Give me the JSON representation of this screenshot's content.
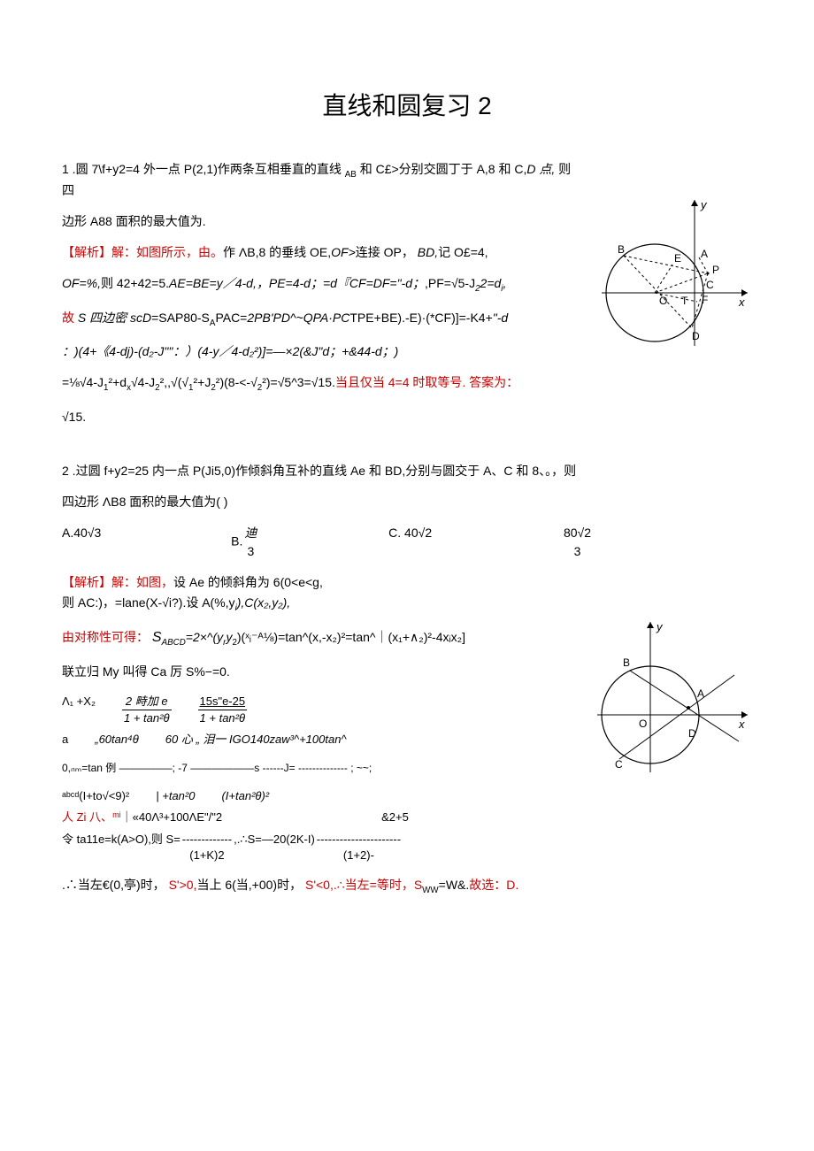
{
  "title": "直线和圆复习 2",
  "p1": {
    "num": "1",
    "stem_a": " .圆 7\\f+y2=4 外一点 P(2,1)作两条互相垂直的直线 ",
    "ab_small": "AB",
    "stem_b": " 和 C£>分别交圆丁于 A,8 和 C,",
    "d_it": "D 点,",
    "stem_c": " 则四",
    "stem_d": "边形 A88 面积的最大值为.",
    "sol_lead": "【解析】解：如图所示，由。",
    "sol_a": "作 ΛB,8 的垂线 OE,",
    "of_it": "OF>",
    "sol_b": "连接 OP，",
    "bd_it": "BD,",
    "sol_c": "记 O£=4,",
    "of_line_a": "OF=%,",
    "of_line_b": "则 42+42=5.",
    "of_line_c": "AE=BE=y／4-d,，PE=4-d；=d『CF=DF=\"-d；",
    "of_line_d": ",PF=√5-J",
    "of_line_e": "2",
    "of_line_f": "2=d",
    "of_line_g": "i",
    "of_line_h": ",",
    "s_line_a": "故 ",
    "s_line_b": "S 四边密 scD",
    "s_line_c": "=SAP80-S",
    "s_line_d": "A",
    "s_line_e": "PAC=",
    "s_line_f": "2PB'PD^~QPA·PC",
    "s_line_g": "TPE+BE).-E)·(*CF)]=-K4+",
    "s_line_h": "\"-d",
    "paren_line": "：)(4+《4-dj)-(d₂-J\"\"：）(4-y／4-d₂²)]=—×2(&J\"d；+&44-d；)",
    "eq_line_a": "=⅛√4-J",
    "eq_line_b": "1",
    "eq_line_c": "²+d",
    "eq_line_d": "x",
    "eq_line_e": "√4-J",
    "eq_line_f": "2",
    "eq_line_g": "²,,√(√",
    "eq_line_h": "1",
    "eq_line_i": "²+J",
    "eq_line_j": "2",
    "eq_line_k": "²)(8-<-√",
    "eq_line_l": "2",
    "eq_line_m": "²)=√5^3=√15.",
    "eq_red": "当且仅当 4=4 时取等号. 答案为：",
    "ans": "√15."
  },
  "p2": {
    "num": "2",
    "stem_a": " .过圆 f+y2=25 内一点 P(Ji5,0)作倾斜角互补的直线 Ae 和 BD,分别与圆交于 A、C 和 8、。，则",
    "stem_b": "四边形 ΛB8 面积的最大值为(        )",
    "optA": "A.40√3",
    "optB_a": "B.",
    "optB_b": "迪",
    "optB_c": "3",
    "optC": "C. 40√2",
    "optD_a": "80√2",
    "optD_b": "3",
    "sol_lead": "【解析】解：如图，",
    "sol_a": "设 Ae 的倾斜角为 6(0<e<g,",
    "sol_b": "则 AC:)，=lane(X-√i?).设 A(%,y",
    "sol_c": "i",
    "sol_d": "),C(x₂,y₂),",
    "sym_a": "由对称性可得：",
    "sym_b": "S",
    "sym_c": "ABCD",
    "sym_d": "=2×^(y",
    "sym_e": "r",
    "sym_f": "y",
    "sym_g": "2",
    "sym_h": ")(ˣᵢ⁻ᴬ⅛)=tan^(x,-x₂)²=tan^｜(x₁+∧₂)²-4xᵢx₂]",
    "joint": "联立归 My 叫得 Ca 厉 S%−=0.",
    "row1_a": "Λ₁ +X₂",
    "row1_b": "2 畤加 e",
    "row1_bot": "1 + tan²θ",
    "row1_c": "15s\"e-25",
    "row1_cbot": "1 + tan²θ",
    "row2_a": "a",
    "row2_b": "„60tan⁴θ",
    "row2_c": "60 心 „  泪一 IGO140zaw³^+100tan^",
    "row3_a": "0,ₙₘ=tan 例 ―――――;  -7 ――――――s ------J= -------------- ;   ~~;",
    "row4_a": "ᵃᵇᶜᵈ(I+to√<9)²",
    "row4_b": "| +tan²0",
    "row4_c": "(I+tan²θ)²",
    "row5_a": "人 Zi 八、",
    "row5_b": "mi",
    "row5_c": "｜«40Λ³+100ΛE\"/\"2",
    "row5_d": "&2+5",
    "row6_a": "令 ta11e=k(A>O),则 S= ",
    "row6_b": "-------------",
    "row6_c": ",.∴S=—20(2K-I)",
    "row6_bot1": "(1+K)2",
    "row6_d": "----------------------",
    "row6_bot2": "(1+2)-",
    "concl_a": ".∴当左€(0,亭)时，",
    "concl_b": " S'>0,",
    "concl_c": "当上 6(当,+00)时，",
    "concl_d": " S'<0,.∴当左=等时，S",
    "concl_e": "WW",
    "concl_f": "=W&.",
    "concl_g": "故选：D."
  }
}
